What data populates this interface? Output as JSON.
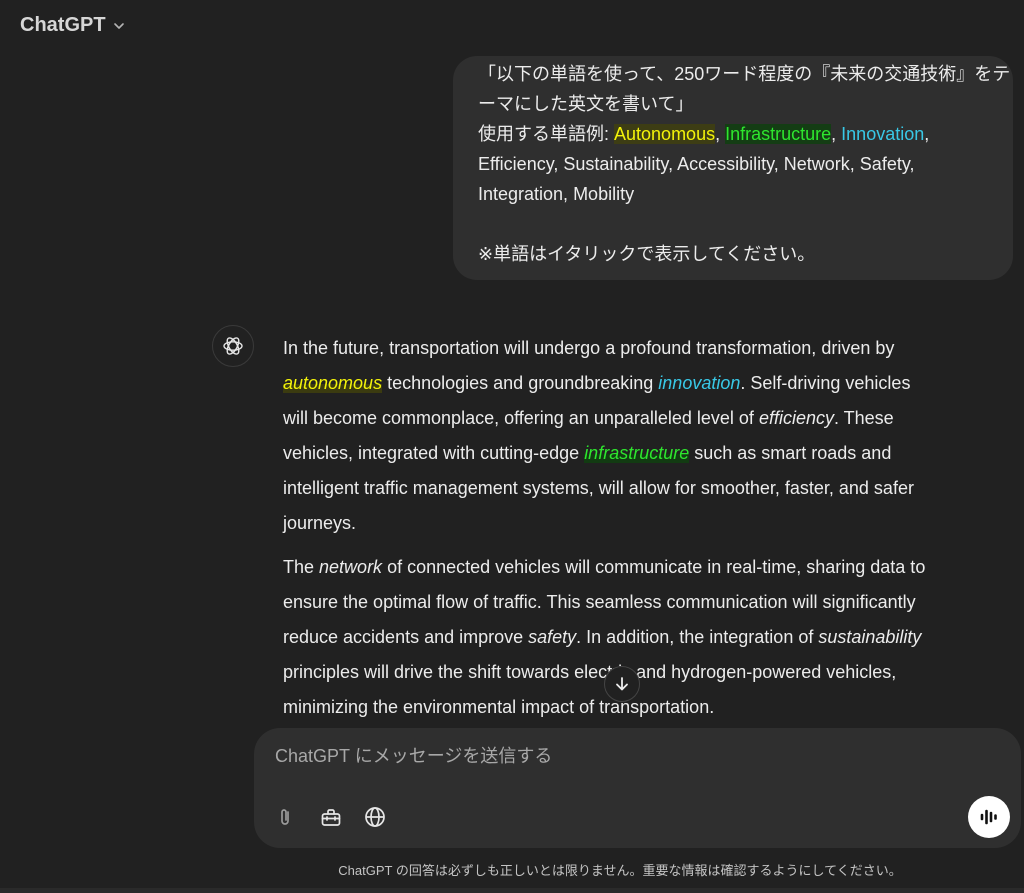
{
  "header": {
    "model_name": "ChatGPT"
  },
  "user_message": {
    "line1": "「以下の単語を使って、250ワード程度の『未来の交通技術』をテ",
    "line2": "ーマにした英文を書いて」",
    "line3_prefix": "使用する単語例: ",
    "word_autonomous": "Autonomous",
    "sep1": ", ",
    "word_infrastructure": "Infrastructure",
    "sep2": ", ",
    "word_innovation": "Innovation",
    "sep3": ",",
    "line4": "Efficiency, Sustainability, Accessibility, Network, Safety,",
    "line5": "Integration, Mobility",
    "line6": "※単語はイタリックで表示してください。"
  },
  "assistant_message": {
    "p1": {
      "l1": "In the future, transportation will undergo a profound transformation, driven by",
      "l2_w1": "autonomous",
      "l2_t1": " technologies and groundbreaking ",
      "l2_w2": "innovation",
      "l2_t2": ". Self-driving vehicles",
      "l3_t1": "will become commonplace, offering an unparalleled level of ",
      "l3_w1": "efficiency",
      "l3_t2": ". These",
      "l4_t1": "vehicles, integrated with cutting-edge ",
      "l4_w1": "infrastructure",
      "l4_t2": " such as smart roads and",
      "l5": "intelligent traffic management systems, will allow for smoother, faster, and safer",
      "l6": "journeys."
    },
    "p2": {
      "l1_t1": "The ",
      "l1_w1": "network",
      "l1_t2": " of connected vehicles will communicate in real-time, sharing data to",
      "l2": "ensure the optimal flow of traffic. This seamless communication will significantly",
      "l3_t1": "reduce accidents and improve ",
      "l3_w1": "safety",
      "l3_t2": ". In addition, the integration of ",
      "l3_w2": "sustainability",
      "l4": "principles will drive the shift towards electric and hydrogen-powered vehicles,",
      "l5": "minimizing the environmental impact of transportation."
    }
  },
  "composer": {
    "placeholder": "ChatGPT にメッセージを送信する"
  },
  "footer": {
    "disclaimer": "ChatGPT の回答は必ずしも正しいとは限りません。重要な情報は確認するようにしてください。"
  },
  "colors": {
    "background": "#212121",
    "bubble": "#2f2f2f",
    "highlight_yellow": "#f2f20a",
    "highlight_green": "#2ee62e",
    "highlight_cyan": "#39c8e6"
  },
  "icons": [
    "chevron-down-icon",
    "openai-logo-icon",
    "arrow-down-icon",
    "paperclip-icon",
    "tools-icon",
    "globe-icon",
    "voice-waveform-icon"
  ]
}
